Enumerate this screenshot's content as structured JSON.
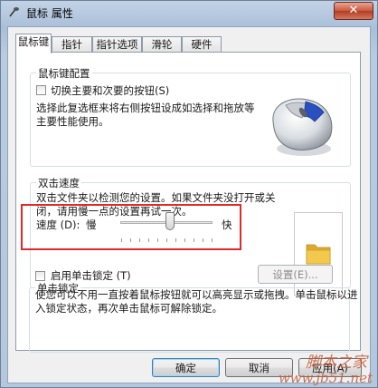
{
  "window": {
    "title": "鼠标 属性",
    "close_glyph": "✕"
  },
  "tabs": [
    {
      "label": "鼠标键",
      "active": true
    },
    {
      "label": "指针",
      "active": false
    },
    {
      "label": "指针选项",
      "active": false
    },
    {
      "label": "滑轮",
      "active": false
    },
    {
      "label": "硬件",
      "active": false
    }
  ],
  "button_config": {
    "group_label": "鼠标键配置",
    "checkbox_label": "切换主要和次要的按钮(S)",
    "checked": false,
    "description": "选择此复选框来将右侧按钮设成如选择和拖放等主要性能使用。"
  },
  "double_click": {
    "group_label": "双击速度",
    "description": "双击文件夹以检测您的设置。如果文件夹没打开或关闭，请用慢一点的设置再试一次。",
    "speed_label": "速度 (D):",
    "slow_label": "慢",
    "fast_label": "快",
    "speed_fraction": 0.55
  },
  "click_lock": {
    "group_label": "单击锁定",
    "checkbox_label": "启用单击锁定 (T)",
    "checked": false,
    "settings_button": "设置(E)...",
    "description": "使您可以不用一直按着鼠标按钮就可以高亮显示或拖拽。单击鼠标以进入锁定状态，再次单击鼠标可解除锁定。"
  },
  "footer": {
    "ok_label": "确定",
    "cancel_label": "取消",
    "apply_label": "应用(A)"
  },
  "watermark": {
    "text": "脚本之家",
    "url": "www.jb51.net"
  },
  "colors": {
    "highlight_border": "#e02a2a",
    "folder": "#f2c94c",
    "mouse_accent": "#2a4fbf"
  }
}
